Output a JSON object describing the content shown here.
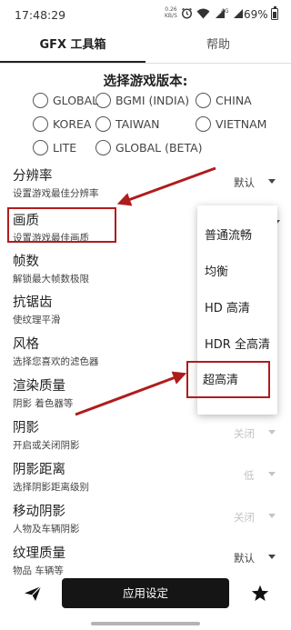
{
  "status_bar": {
    "time": "17:48:29",
    "net_speed": "0.26",
    "net_unit": "KB/S",
    "signal_label": "4G",
    "battery": "69%"
  },
  "tabs": [
    "GFX 工具箱",
    "帮助"
  ],
  "version_section": {
    "title": "选择游戏版本:",
    "options": [
      "GLOBAL",
      "BGMI (INDIA)",
      "CHINA",
      "KOREA",
      "TAIWAN",
      "VIETNAM",
      "LITE",
      "GLOBAL (BETA)"
    ]
  },
  "settings": [
    {
      "title": "分辨率",
      "subtitle": "设置游戏最佳分辨率",
      "value": "默认"
    },
    {
      "title": "画质",
      "subtitle": "设置游戏最佳画质",
      "value": ""
    },
    {
      "title": "帧数",
      "subtitle": "解锁最大帧数极限",
      "value": ""
    },
    {
      "title": "抗锯齿",
      "subtitle": "使纹理平滑",
      "value": ""
    },
    {
      "title": "风格",
      "subtitle": "选择您喜欢的滤色器",
      "value": ""
    },
    {
      "title": "渲染质量",
      "subtitle": "阴影 着色器等",
      "value": ""
    },
    {
      "title": "阴影",
      "subtitle": "开启或关闭阴影",
      "value": "关闭"
    },
    {
      "title": "阴影距离",
      "subtitle": "选择阴影距离级别",
      "value": "低"
    },
    {
      "title": "移动阴影",
      "subtitle": "人物及车辆阴影",
      "value": "关闭"
    },
    {
      "title": "纹理质量",
      "subtitle": "物品 车辆等",
      "value": "默认"
    }
  ],
  "quality_menu": {
    "options": [
      "普通流畅",
      "均衡",
      "HD 高清",
      "HDR 全高清",
      "超高清"
    ]
  },
  "bottom_bar": {
    "share_icon": "send-icon",
    "apply_label": "应用设定",
    "star_icon": "star-icon"
  },
  "colors": {
    "annotation_red": "#b01c1c",
    "apply_button": "#151515"
  }
}
